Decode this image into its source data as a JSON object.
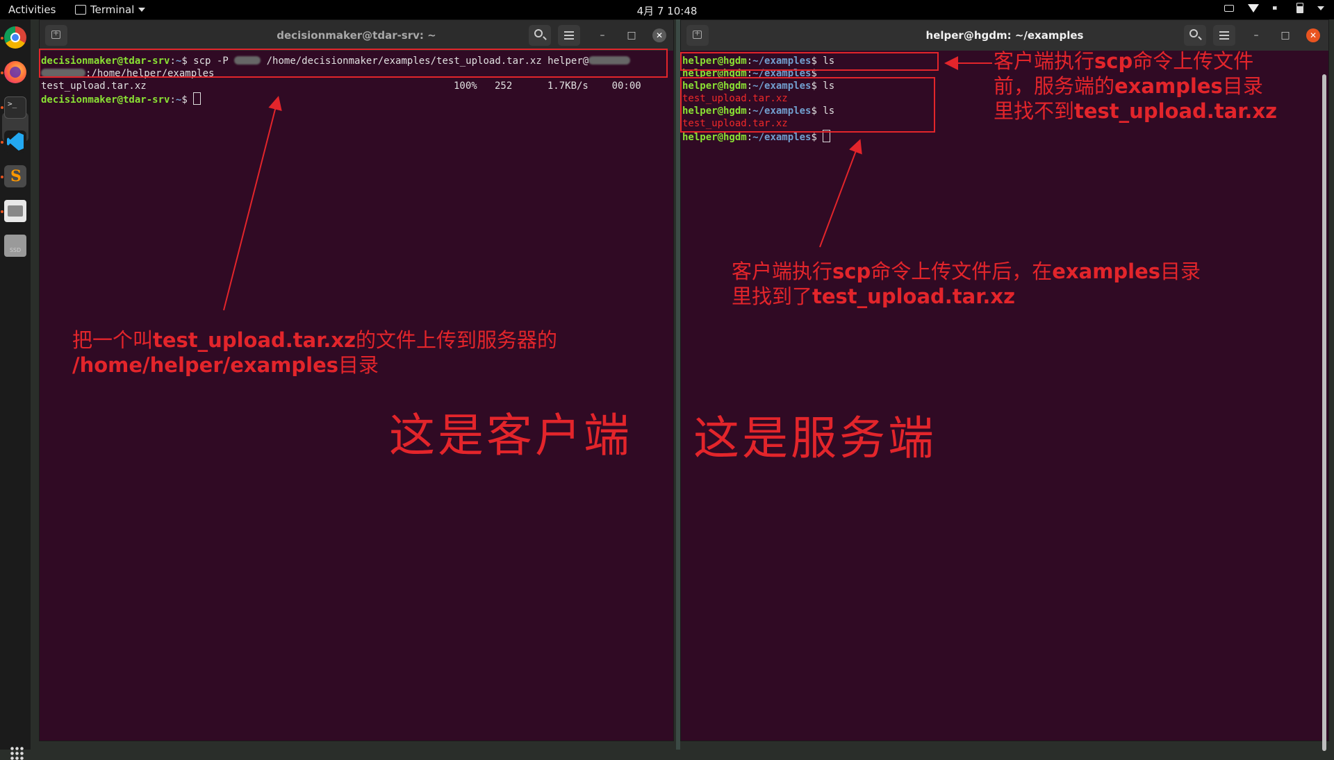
{
  "topbar": {
    "activities": "Activities",
    "app_name": "Terminal",
    "clock": "4月 7  10:48"
  },
  "left_terminal": {
    "title": "decisionmaker@tdar-srv: ~",
    "lines": {
      "l1_user": "decisionmaker@tdar-srv",
      "l1_path": "~",
      "l1_cmd": "$ scp -P ",
      "l1_cmd2": " /home/decisionmaker/examples/test_upload.tar.xz helper@",
      "l2_text": ":/home/helper/examples",
      "l3_file": "test_upload.tar.xz",
      "l3_progress": "100%   252      1.7KB/s    00:00",
      "l4_user": "decisionmaker@tdar-srv",
      "l4_path": "~",
      "l4_prompt": "$ "
    }
  },
  "right_terminal": {
    "title": "helper@hgdm: ~/examples",
    "user": "helper@hgdm",
    "path": "~/examples",
    "cmd_ls": "$ ls",
    "prompt": "$",
    "prompt_cursor": "$ ",
    "listed_file": "test_upload.tar.xz"
  },
  "annotations": {
    "left_note_1a": "把一个叫",
    "left_note_1b": "test_upload.tar.xz",
    "left_note_1c": "的文件上传到服务器的",
    "left_note_2a": "/home/helper/examples",
    "left_note_2b": "目录",
    "client_label": "这是客户端",
    "server_label": "这是服务端",
    "right_top_1a": "客户端执行",
    "right_top_1b": "scp",
    "right_top_1c": "命令上传文件",
    "right_top_2a": "前，服务端的",
    "right_top_2b": "examples",
    "right_top_2c": "目录",
    "right_top_3a": "里找不到",
    "right_top_3b": "test_upload.tar.xz",
    "right_mid_1a": "客户端执行",
    "right_mid_1b": "scp",
    "right_mid_1c": "命令上传文件后，在",
    "right_mid_1d": "examples",
    "right_mid_1e": "目录",
    "right_mid_2a": "里找到了",
    "right_mid_2b": "test_upload.tar.xz"
  },
  "colors": {
    "terminal_bg": "#300a24",
    "annotation_red": "#e3252b",
    "prompt_user": "#8ae234",
    "prompt_path": "#729fcf",
    "accent": "#e95420"
  }
}
